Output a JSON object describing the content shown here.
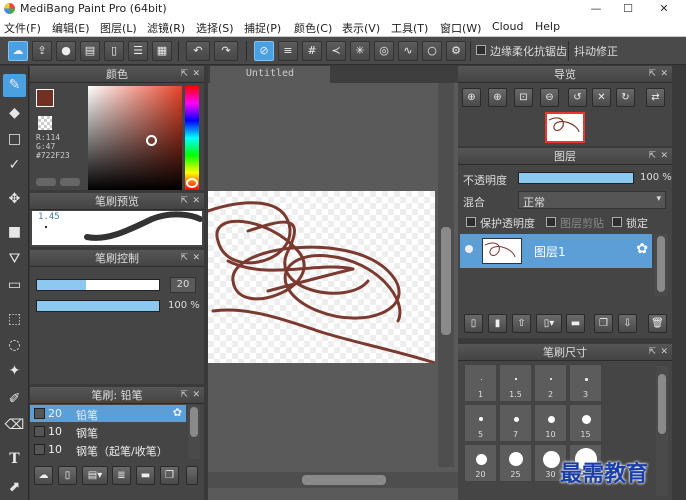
{
  "window": {
    "title": "MediBang Paint Pro (64bit)",
    "minimize": "—",
    "maximize": "☐",
    "close": "✕"
  },
  "menu": [
    "文件(F)",
    "编辑(E)",
    "图层(L)",
    "滤镜(R)",
    "选择(S)",
    "捕捉(P)",
    "颜色(C)",
    "表示(V)",
    "工具(T)",
    "窗口(W)",
    "Cloud",
    "Help"
  ],
  "toolbar": {
    "antialias_label": "边缘柔化抗锯齿",
    "stabilizer_label": "抖动修正"
  },
  "color_panel": {
    "title": "颜色",
    "r": "R:114",
    "g": "G:47",
    "hex": "#722F23",
    "current_color": "#722F23"
  },
  "brush_preview": {
    "title": "笔刷预览",
    "size": "1.45"
  },
  "brush_control": {
    "title": "笔刷控制",
    "size_value": "20",
    "size_fraction": 0.4,
    "opacity_value": "100 %",
    "opacity_fraction": 1.0
  },
  "brush_list": {
    "title": "笔刷: 铅笔",
    "items": [
      {
        "size": "20",
        "name": "铅笔",
        "selected": true
      },
      {
        "size": "10",
        "name": "钢笔",
        "selected": false
      },
      {
        "size": "10",
        "name": "钢笔（起笔/收笔）",
        "selected": false
      }
    ]
  },
  "canvas": {
    "tab_title": "Untitled",
    "stroke_color": "#7a3a30"
  },
  "navigator": {
    "title": "导览"
  },
  "layers": {
    "title": "图层",
    "opacity_label": "不透明度",
    "opacity_value": "100 %",
    "opacity_fraction": 1.0,
    "blend_label": "混合",
    "blend_value": "正常",
    "protect_alpha": "保护透明度",
    "clipping": "图层剪贴",
    "lock": "锁定",
    "layer_name": "图层1"
  },
  "brush_size": {
    "title": "笔刷尺寸",
    "sizes": [
      "1",
      "1.5",
      "2",
      "3",
      "5",
      "7",
      "10",
      "15",
      "20",
      "25",
      "30",
      "50"
    ]
  },
  "watermark": "最需教育",
  "colors": {
    "accent": "#4aa0e0",
    "selection": "#5b9fd6",
    "panel": "#454545"
  }
}
